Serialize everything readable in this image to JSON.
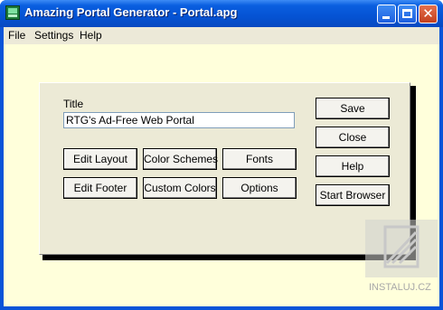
{
  "window": {
    "title": "Amazing Portal Generator - Portal.apg",
    "app_icon": "portal-app-icon",
    "controls": {
      "minimize": "minimize-icon",
      "maximize": "maximize-icon",
      "close": "close-icon",
      "close_glyph": "✕"
    }
  },
  "menu": [
    "File",
    "Settings",
    "Help"
  ],
  "form": {
    "title_label": "Title",
    "title_value": "RTG's Ad-Free Web Portal"
  },
  "buttons": {
    "edit_layout": "Edit Layout",
    "color_schemes": "Color Schemes",
    "fonts": "Fonts",
    "edit_footer": "Edit Footer",
    "custom_colors": "Custom Colors",
    "options": "Options",
    "save": "Save",
    "close": "Close",
    "help": "Help",
    "start_browser": "Start Browser"
  },
  "watermark": {
    "text": "INSTALUJ.CZ"
  },
  "colors": {
    "titlebar": "#0553d4",
    "client_bg": "#ffffdb",
    "panel_bg": "#ecead6",
    "menubar": "#ece9d8"
  }
}
